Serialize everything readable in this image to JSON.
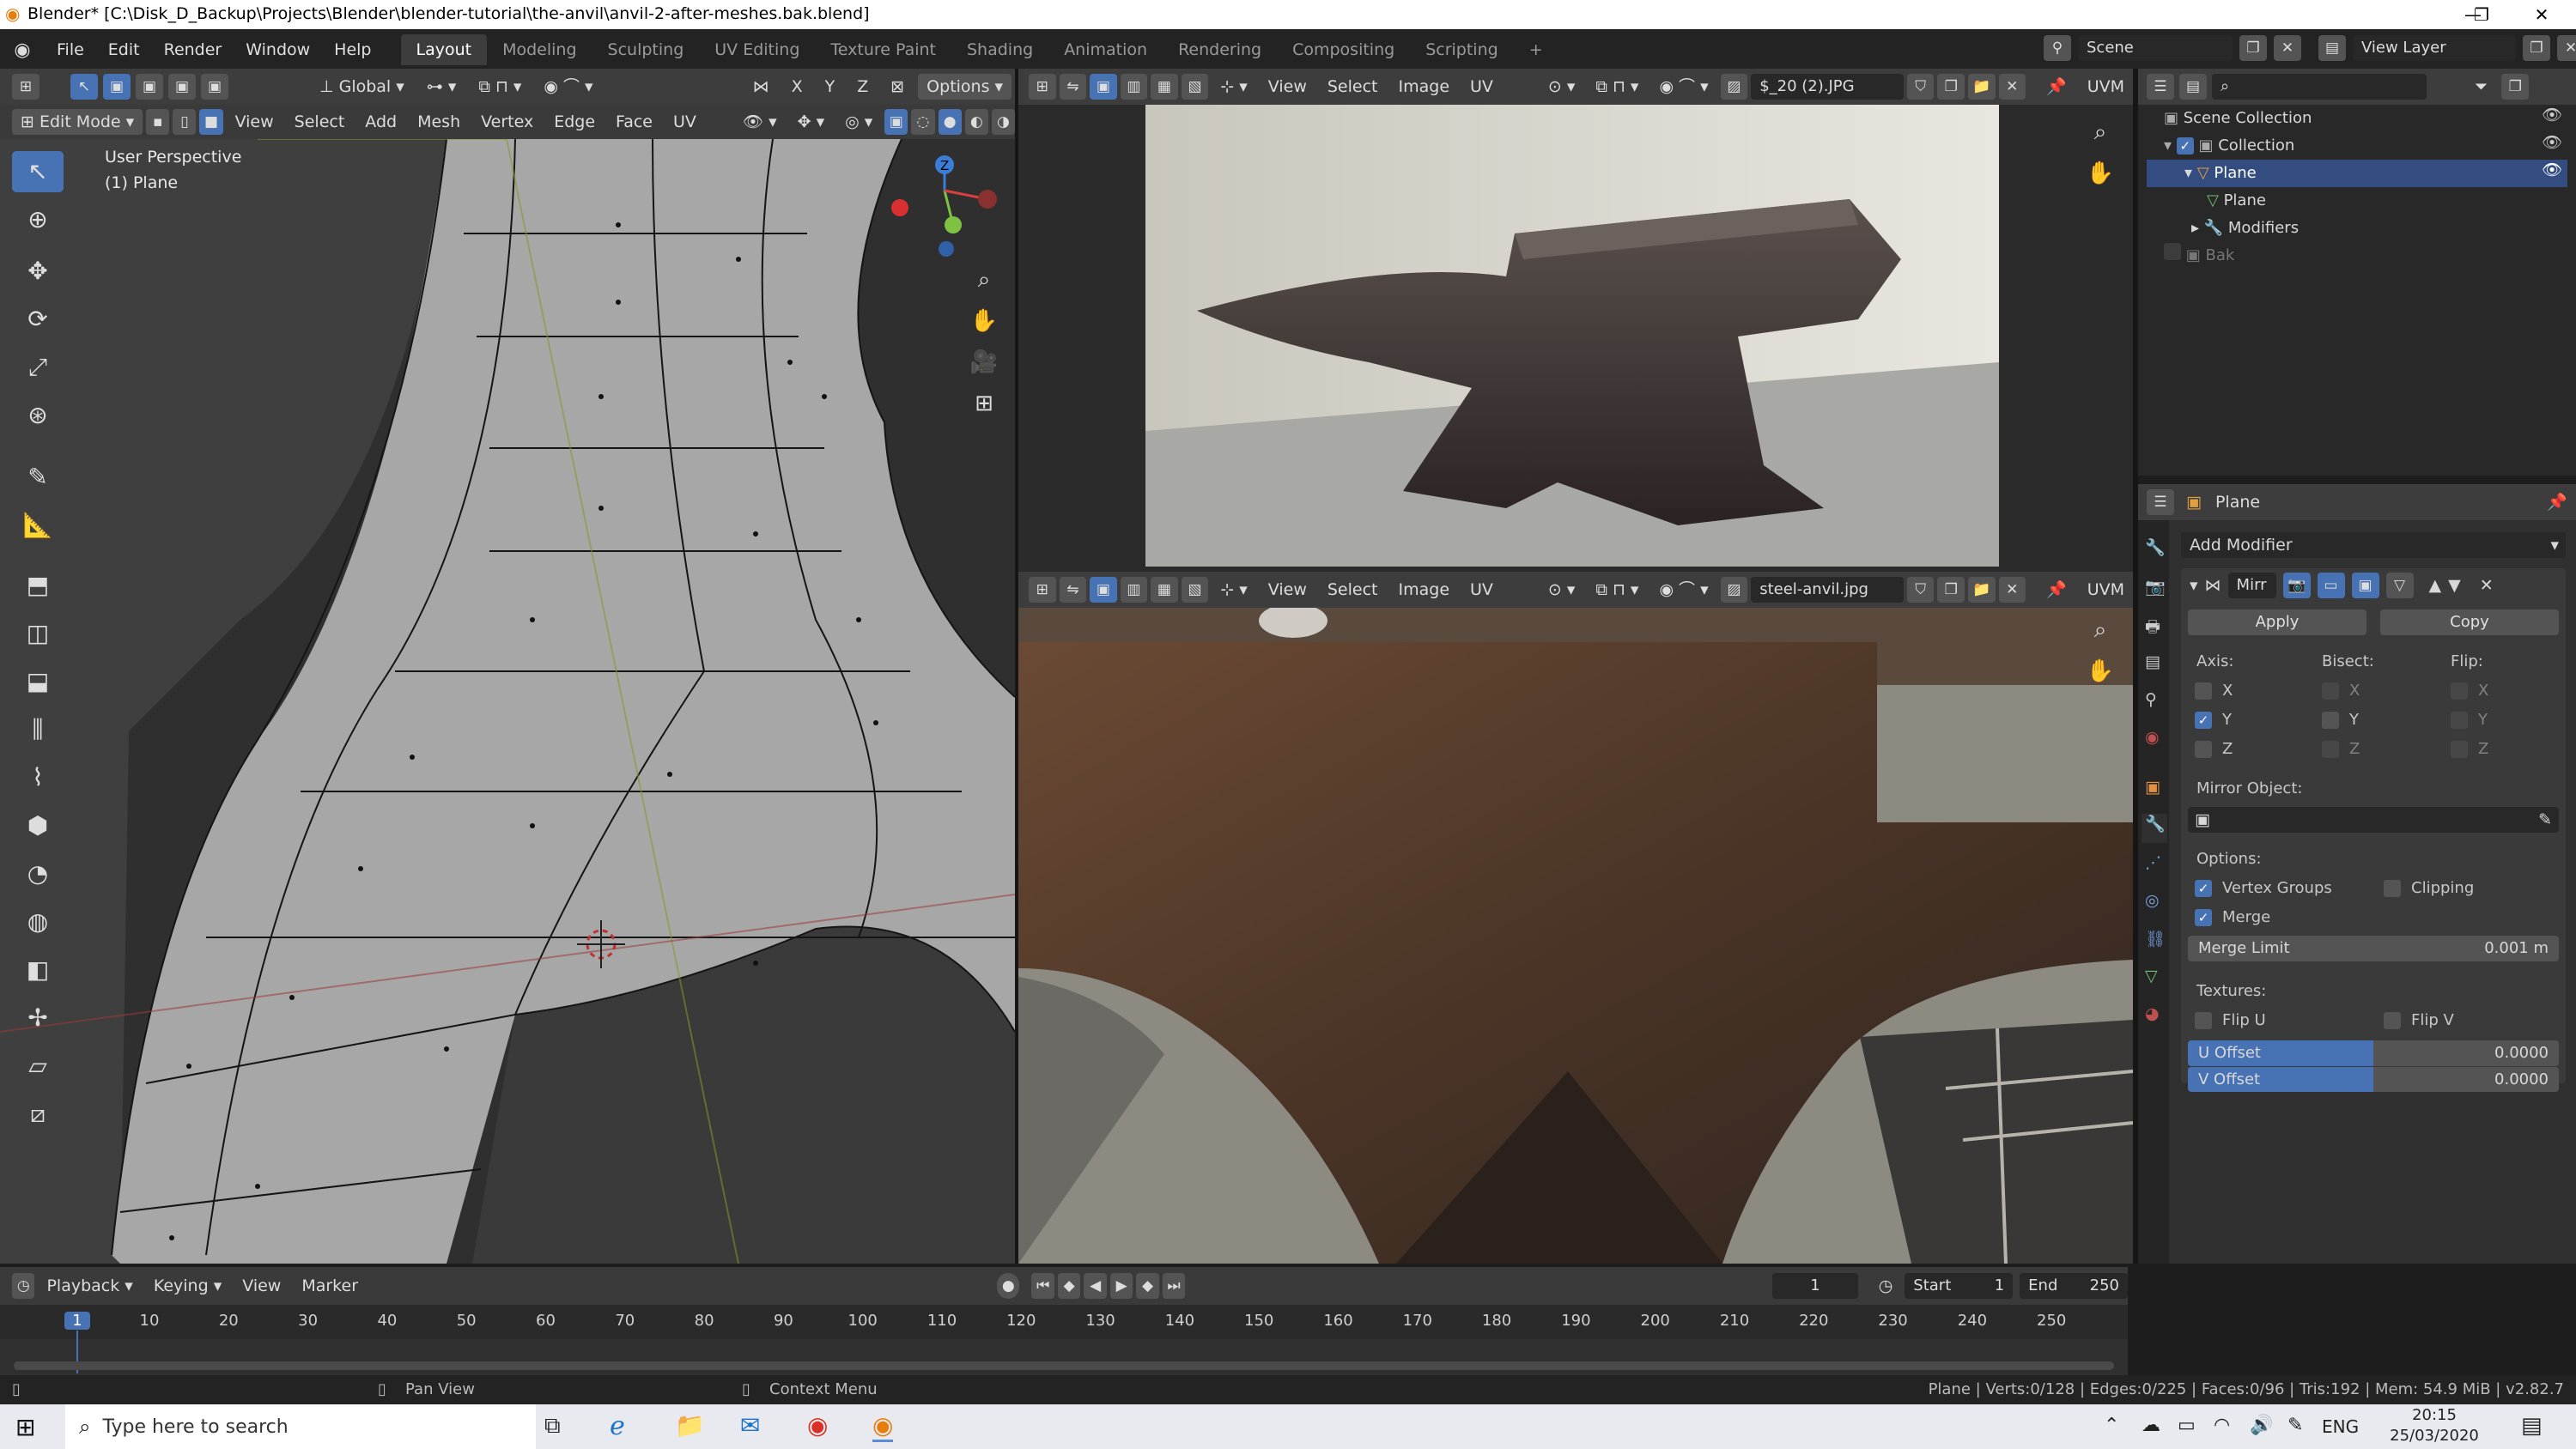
{
  "window": {
    "title": "Blender* [C:\\Disk_D_Backup\\Projects\\Blender\\blender-tutorial\\the-anvil\\anvil-2-after-meshes.bak.blend]"
  },
  "menu": [
    "File",
    "Edit",
    "Render",
    "Window",
    "Help"
  ],
  "workspaces": [
    "Layout",
    "Modeling",
    "Sculpting",
    "UV Editing",
    "Texture Paint",
    "Shading",
    "Animation",
    "Rendering",
    "Compositing",
    "Scripting"
  ],
  "scene": {
    "name": "Scene",
    "view_layer": "View Layer"
  },
  "viewport": {
    "mode": "Edit Mode",
    "menus": [
      "View",
      "Select",
      "Add",
      "Mesh",
      "Vertex",
      "Edge",
      "Face",
      "UV"
    ],
    "orientation": "Global",
    "options": "Options",
    "axes": [
      "X",
      "Y",
      "Z"
    ],
    "overlay_title": "User Perspective",
    "overlay_object": "(1) Plane",
    "gizmo": {
      "z": "Z",
      "y": "Y"
    }
  },
  "image_editor_top": {
    "menus": [
      "View",
      "Select",
      "Image",
      "UV"
    ],
    "image": "$_20 (2).JPG",
    "uvmap": "UVM"
  },
  "image_editor_bottom": {
    "menus": [
      "View",
      "Select",
      "Image",
      "UV"
    ],
    "image": "steel-anvil.jpg",
    "uvmap": "UVM"
  },
  "outliner": {
    "items": [
      {
        "label": "Scene Collection",
        "indent": 0
      },
      {
        "label": "Collection",
        "indent": 1
      },
      {
        "label": "Plane",
        "indent": 2,
        "selected": true
      },
      {
        "label": "Plane",
        "indent": 3
      },
      {
        "label": "Modifiers",
        "indent": 3
      },
      {
        "label": "Bak",
        "indent": 1,
        "dim": true
      }
    ]
  },
  "properties": {
    "object": "Plane",
    "add_modifier": "Add Modifier",
    "modifier_name": "Mirr",
    "apply": "Apply",
    "copy": "Copy",
    "axis_label": "Axis:",
    "bisect_label": "Bisect:",
    "flip_label": "Flip:",
    "axes": [
      {
        "name": "X",
        "axis": false
      },
      {
        "name": "Y",
        "axis": true
      },
      {
        "name": "Z",
        "axis": false
      }
    ],
    "mirror_object_label": "Mirror Object:",
    "options_label": "Options:",
    "vertex_groups": "Vertex Groups",
    "clipping": "Clipping",
    "merge": "Merge",
    "merge_limit_label": "Merge Limit",
    "merge_limit_value": "0.001 m",
    "textures_label": "Textures:",
    "flip_u": "Flip U",
    "flip_v": "Flip V",
    "u_offset_label": "U Offset",
    "u_offset_value": "0.0000",
    "v_offset_label": "V Offset",
    "v_offset_value": "0.0000"
  },
  "timeline": {
    "menus": [
      "Playback",
      "Keying",
      "View",
      "Marker"
    ],
    "current_frame": "1",
    "start_label": "Start",
    "start": "1",
    "end_label": "End",
    "end": "250",
    "ruler": [
      "1",
      "10",
      "20",
      "30",
      "40",
      "50",
      "60",
      "70",
      "80",
      "90",
      "100",
      "110",
      "120",
      "130",
      "140",
      "150",
      "160",
      "170",
      "180",
      "190",
      "200",
      "210",
      "220",
      "230",
      "240",
      "250"
    ]
  },
  "status": {
    "left": "Pan View",
    "mid": "Context Menu",
    "right": "Plane | Verts:0/128 | Edges:0/225 | Faces:0/96 | Tris:192 | Mem: 54.9 MiB | v2.82.7"
  },
  "taskbar": {
    "search": "Type here to search",
    "lang": "ENG",
    "time": "20:15",
    "date": "25/03/2020"
  }
}
